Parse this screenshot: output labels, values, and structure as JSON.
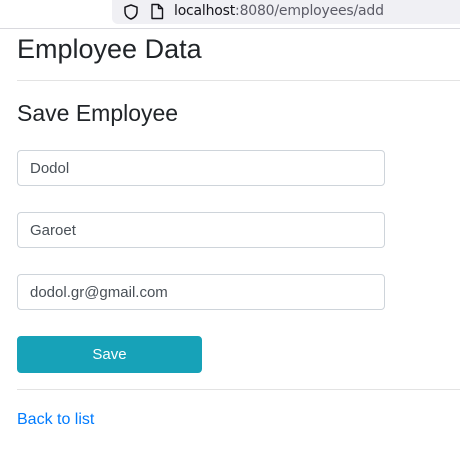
{
  "browser": {
    "url_host": "localhost",
    "url_path": ":8080/employees/add",
    "icons": [
      "shield-icon",
      "page-icon"
    ]
  },
  "page": {
    "title": "Employee Data",
    "section_title": "Save Employee"
  },
  "form": {
    "first_name_value": "Dodol",
    "last_name_value": "Garoet",
    "email_value": "dodol.gr@gmail.com",
    "save_label": "Save"
  },
  "footer": {
    "back_link_label": "Back to list"
  },
  "colors": {
    "button": "#17a2b8",
    "link": "#007bff"
  }
}
